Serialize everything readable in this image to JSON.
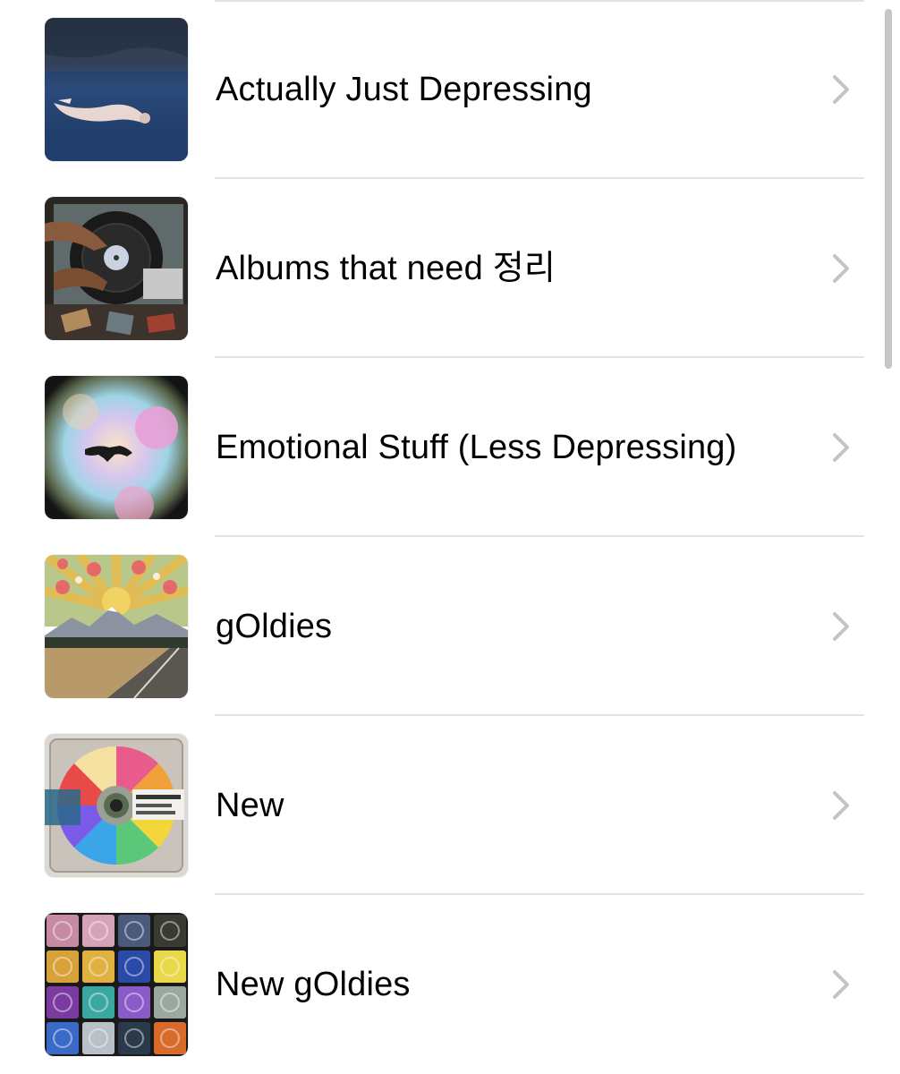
{
  "playlists": [
    {
      "title": "Actually Just Depressing",
      "artwork": "woman-floating-in-water-cover"
    },
    {
      "title": "Albums that need 정리",
      "artwork": "hands-on-turntable-cover"
    },
    {
      "title": "Emotional Stuff (Less Depressing)",
      "artwork": "figure-falling-in-rainbow-cover"
    },
    {
      "title": "gOldies",
      "artwork": "mountain-road-sunburst-cover"
    },
    {
      "title": "New",
      "artwork": "rainbow-minidisc-cover"
    },
    {
      "title": "New gOldies",
      "artwork": "minidisc-grid-cover"
    }
  ],
  "disclosure_icon": "chevron-right-icon",
  "colors": {
    "background": "#ffffff",
    "text": "#000000",
    "separator": "#e2e2e4",
    "chevron": "#c4c4c7",
    "scrollbar": "#c6c6c8"
  }
}
